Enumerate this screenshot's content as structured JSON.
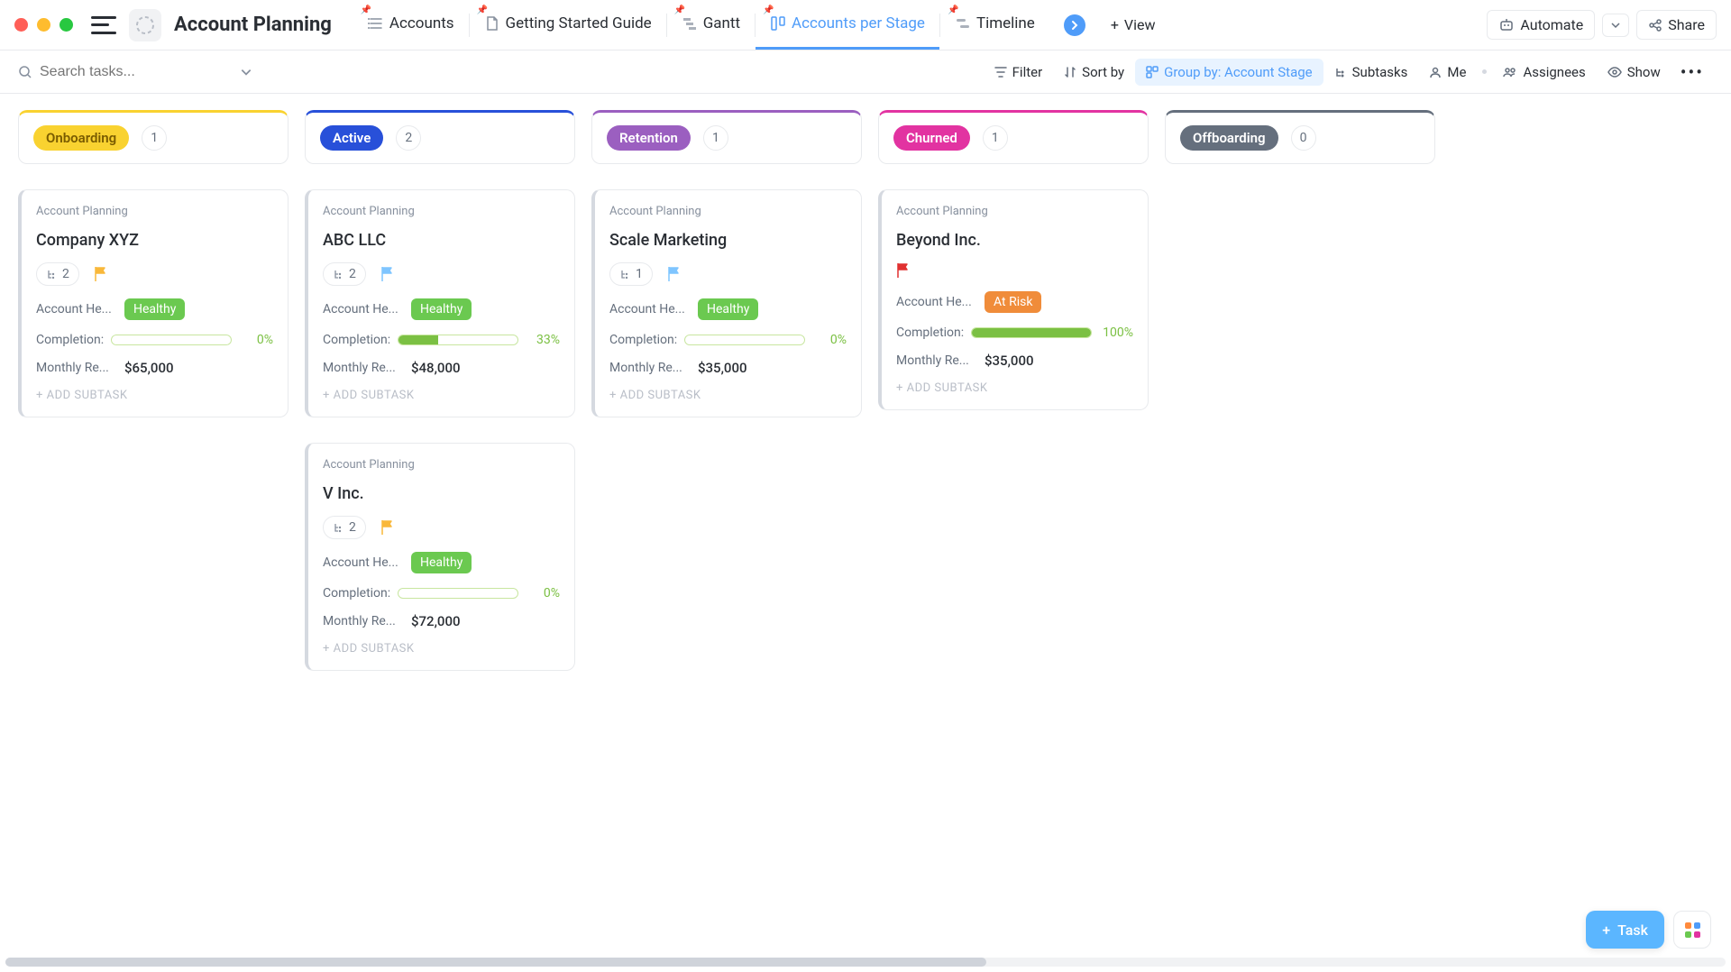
{
  "header": {
    "title": "Account Planning",
    "tabs": [
      {
        "label": "Accounts",
        "icon": "list"
      },
      {
        "label": "Getting Started Guide",
        "icon": "doc"
      },
      {
        "label": "Gantt",
        "icon": "gantt"
      },
      {
        "label": "Accounts per Stage",
        "icon": "board",
        "active": true
      },
      {
        "label": "Timeline",
        "icon": "timeline"
      }
    ],
    "view_label": "View",
    "automate_label": "Automate",
    "share_label": "Share"
  },
  "toolbar": {
    "search_placeholder": "Search tasks...",
    "filter": "Filter",
    "sort": "Sort by",
    "group": "Group by: Account Stage",
    "subtasks": "Subtasks",
    "me": "Me",
    "assignees": "Assignees",
    "show": "Show"
  },
  "fields": {
    "health_label": "Account He...",
    "completion_label": "Completion:",
    "revenue_label": "Monthly Re...",
    "add_subtask": "+ ADD SUBTASK",
    "crumb": "Account Planning"
  },
  "columns": [
    {
      "name": "Onboarding",
      "count": 1,
      "pill_bg": "#f9d230",
      "pill_fg": "#7a5c00",
      "border": "#f9d230",
      "cards": [
        {
          "title": "Company XYZ",
          "subtasks": 2,
          "flag_color": "#f9b83a",
          "health": "Healthy",
          "health_bg": "#6bc950",
          "completion": 0,
          "revenue": "$65,000"
        }
      ]
    },
    {
      "name": "Active",
      "count": 2,
      "pill_bg": "#2850d9",
      "pill_fg": "#ffffff",
      "border": "#2850d9",
      "cards": [
        {
          "title": "ABC LLC",
          "subtasks": 2,
          "flag_color": "#7fc5ff",
          "health": "Healthy",
          "health_bg": "#6bc950",
          "completion": 33,
          "revenue": "$48,000"
        },
        {
          "title": "V Inc.",
          "subtasks": 2,
          "flag_color": "#f9b83a",
          "health": "Healthy",
          "health_bg": "#6bc950",
          "completion": 0,
          "revenue": "$72,000"
        }
      ]
    },
    {
      "name": "Retention",
      "count": 1,
      "pill_bg": "#9b5fc0",
      "pill_fg": "#ffffff",
      "border": "#9b5fc0",
      "cards": [
        {
          "title": "Scale Marketing",
          "subtasks": 1,
          "flag_color": "#7fc5ff",
          "health": "Healthy",
          "health_bg": "#6bc950",
          "completion": 0,
          "revenue": "$35,000"
        }
      ]
    },
    {
      "name": "Churned",
      "count": 1,
      "pill_bg": "#e233a1",
      "pill_fg": "#ffffff",
      "border": "#e233a1",
      "cards": [
        {
          "title": "Beyond Inc.",
          "subtasks": 0,
          "flag_color": "#e03131",
          "health": "At Risk",
          "health_bg": "#f08c3a",
          "completion": 100,
          "revenue": "$35,000"
        }
      ]
    },
    {
      "name": "Offboarding",
      "count": 0,
      "pill_bg": "#656f7d",
      "pill_fg": "#ffffff",
      "border": "#656f7d",
      "cards": []
    }
  ],
  "fab": {
    "task": "Task"
  }
}
